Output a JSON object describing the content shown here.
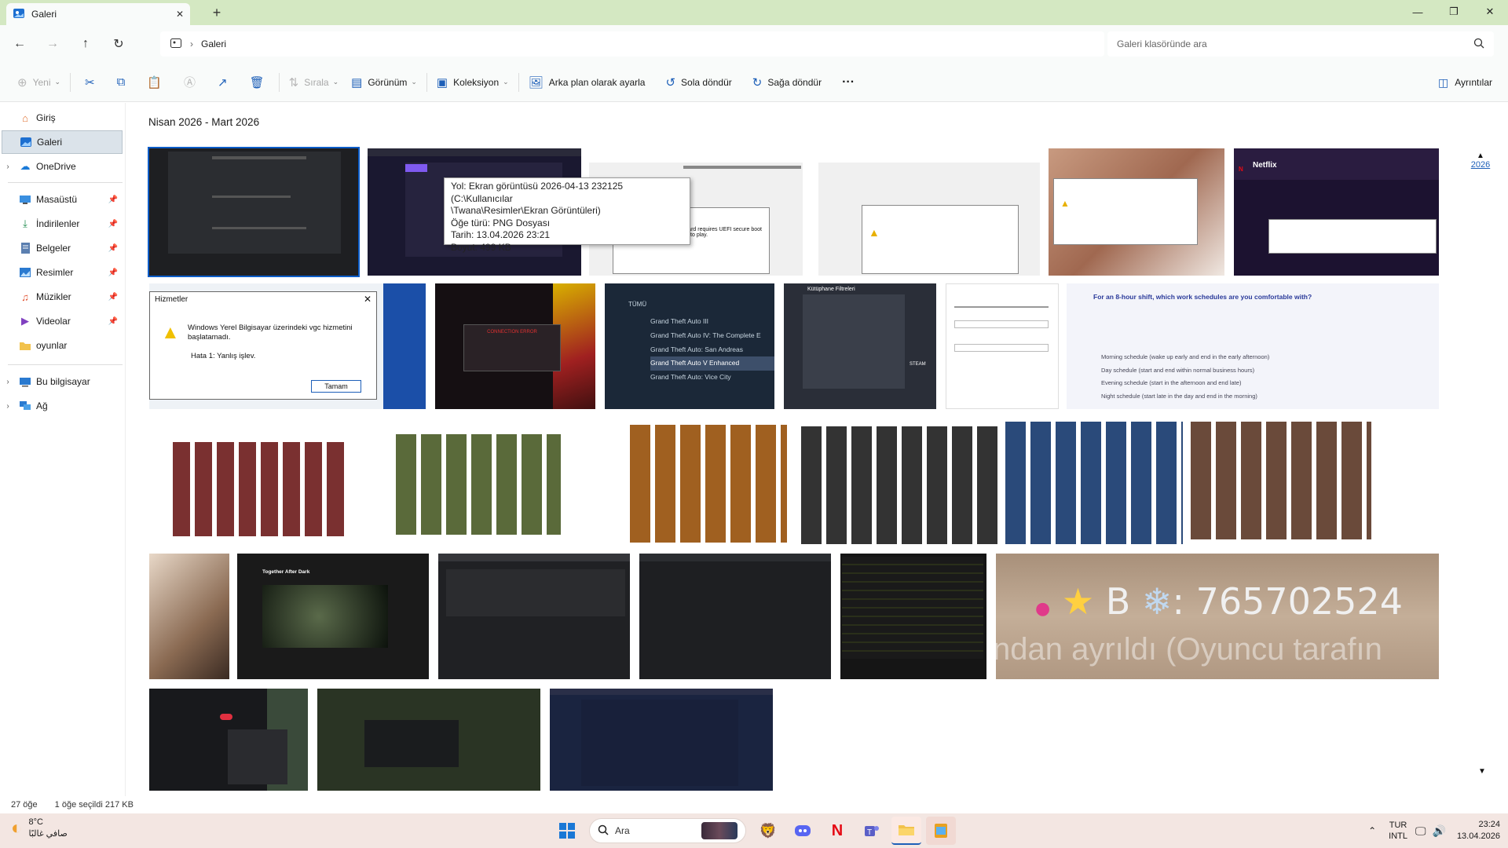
{
  "window": {
    "tab_title": "Galeri",
    "controls": {
      "minimize": "—",
      "maximize": "❐",
      "close": "✕"
    }
  },
  "address": {
    "path": "Galeri",
    "search_placeholder": "Galeri klasöründe ara"
  },
  "toolbar": {
    "new": "Yeni",
    "sort": "Sırala",
    "view": "Görünüm",
    "collection": "Koleksiyon",
    "set_background": "Arka plan olarak ayarla",
    "rotate_left": "Sola döndür",
    "rotate_right": "Sağa döndür",
    "more": "···",
    "details": "Ayrıntılar"
  },
  "sidebar": {
    "items": [
      {
        "label": "Giriş",
        "icon": "home-icon"
      },
      {
        "label": "Galeri",
        "icon": "gallery-icon"
      },
      {
        "label": "OneDrive",
        "icon": "cloud-icon"
      },
      {
        "label": "Masaüstü",
        "icon": "desktop-icon"
      },
      {
        "label": "İndirilenler",
        "icon": "download-icon"
      },
      {
        "label": "Belgeler",
        "icon": "document-icon"
      },
      {
        "label": "Resimler",
        "icon": "pictures-icon"
      },
      {
        "label": "Müzikler",
        "icon": "music-icon"
      },
      {
        "label": "Videolar",
        "icon": "video-icon"
      },
      {
        "label": "oyunlar",
        "icon": "folder-icon"
      },
      {
        "label": "Bu bilgisayar",
        "icon": "computer-icon"
      },
      {
        "label": "Ağ",
        "icon": "network-icon"
      }
    ]
  },
  "gallery": {
    "group_header": "Nisan 2026 - Mart 2026",
    "timeline_year": "2026"
  },
  "tooltip": {
    "line1": "Yol: Ekran görüntüsü 2026-04-13 232125 (C:\\Kullanıcılar",
    "line2": "\\Twana\\Resimler\\Ekran Görüntüleri)",
    "line3": "Öğe türü: PNG Dosyası",
    "line4": "Tarih: 13.04.2026 23:21",
    "line5": "Boyut: 499 KB"
  },
  "dialog_thumb": {
    "title": "Hizmetler",
    "message": "Windows Yerel Bilgisayar üzerindeki vgc hizmetini başlatamadı.",
    "error": "Hata 1: Yanlış işlev.",
    "ok": "Tamam"
  },
  "thumb_texts": {
    "netflix": "Netflix",
    "gta_all": "TÜMÜ",
    "gta_items": [
      "Grand Theft Auto III",
      "Grand Theft Auto IV: The Complete E",
      "Grand Theft Auto: San Andreas",
      "Grand Theft Auto V Enhanced",
      "Grand Theft Auto: Vice City"
    ],
    "library_filters": "Kütüphane Filtreleri",
    "connection_error": "CONNECTION ERROR",
    "survey_title": "For an 8-hour shift, which work schedules are you comfortable with?",
    "survey_options": [
      "Morning schedule (wake up early and end in the early afternoon)",
      "Day schedule (start and end within normal business hours)",
      "Evening schedule (start in the afternoon and end late)",
      "Night schedule (start late in the day and end in the morning)"
    ],
    "together_after_dark": "Together After Dark",
    "game_id": "765702524",
    "game_footer": "ndan ayrıldı (Oyuncu tarafın",
    "vanguard_msg": "This version of Vanguard requires UEFI secure boot to be enabled in order to play.",
    "steam": "STEAM"
  },
  "status": {
    "item_count": "27 öğe",
    "selection": "1 öğe seçildi  217 KB"
  },
  "taskbar": {
    "temp": "8°C",
    "weather_desc": "صافي غالبًا",
    "search": "Ara",
    "lang1": "TUR",
    "lang2": "INTL",
    "time": "23:24",
    "date": "13.04.2026"
  },
  "colors": {
    "accent": "#1d5fb8",
    "titlebar": "#d4e8c2",
    "taskbar": "#f3e6e2"
  }
}
